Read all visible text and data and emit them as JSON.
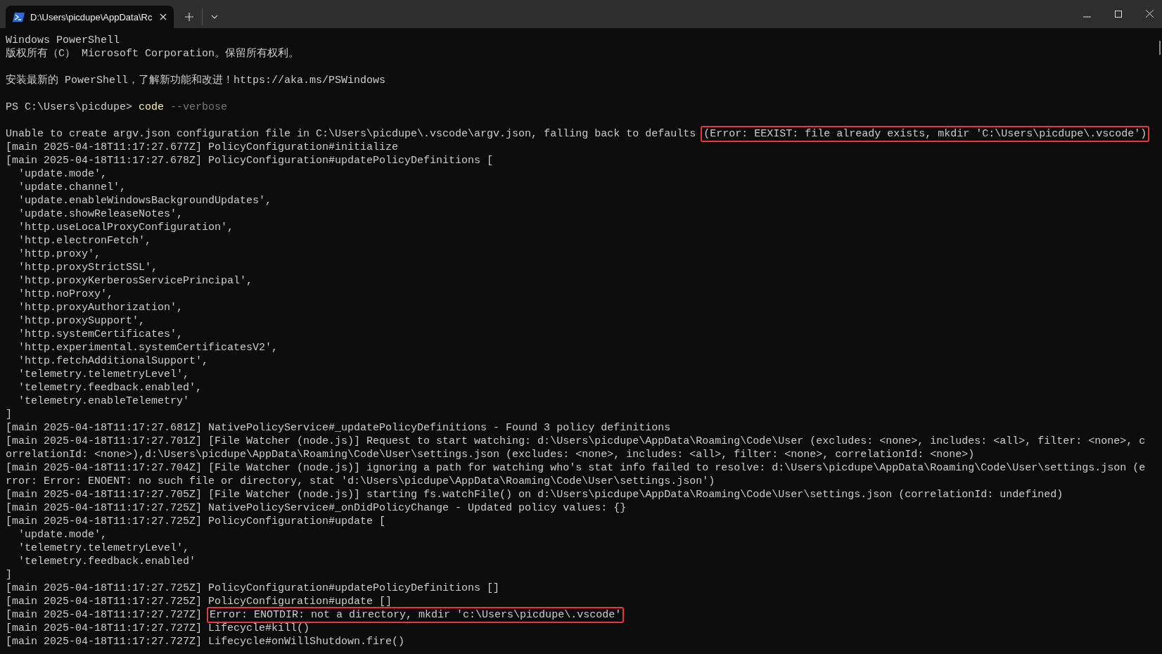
{
  "window": {
    "tab": {
      "title": "D:\\Users\\picdupe\\AppData\\Rc",
      "selected": true
    }
  },
  "terminal": {
    "lines": [
      {
        "kind": "text",
        "segments": [
          {
            "kind": "plain",
            "text": "Windows PowerShell"
          }
        ]
      },
      {
        "kind": "text",
        "segments": [
          {
            "kind": "plain",
            "text": "版权所有（C） Microsoft Corporation。保留所有权利。"
          }
        ]
      },
      {
        "kind": "blank"
      },
      {
        "kind": "text",
        "segments": [
          {
            "kind": "plain",
            "text": "安装最新的 PowerShell，了解新功能和改进！https://aka.ms/PSWindows"
          }
        ]
      },
      {
        "kind": "blank"
      },
      {
        "kind": "text",
        "segments": [
          {
            "kind": "prompt",
            "text": "PS C:\\Users\\picdupe> "
          },
          {
            "kind": "command",
            "text": "code"
          },
          {
            "kind": "parameter",
            "text": " --verbose"
          }
        ]
      },
      {
        "kind": "blank"
      },
      {
        "kind": "text",
        "segments": [
          {
            "kind": "plain",
            "text": "Unable to create argv.json configuration file in C:\\Users\\picdupe\\.vscode\\argv.json, falling back to defaults "
          },
          {
            "kind": "highlight",
            "text": "(Error: EEXIST: file already exists, mkdir 'C:\\Users\\picdupe\\.vscode')"
          }
        ]
      },
      {
        "kind": "text",
        "segments": [
          {
            "kind": "plain",
            "text": "[main 2025-04-18T11:17:27.677Z] PolicyConfiguration#initialize"
          }
        ]
      },
      {
        "kind": "text",
        "segments": [
          {
            "kind": "plain",
            "text": "[main 2025-04-18T11:17:27.678Z] PolicyConfiguration#updatePolicyDefinitions ["
          }
        ]
      },
      {
        "kind": "text",
        "segments": [
          {
            "kind": "plain",
            "text": "  'update.mode',"
          }
        ]
      },
      {
        "kind": "text",
        "segments": [
          {
            "kind": "plain",
            "text": "  'update.channel',"
          }
        ]
      },
      {
        "kind": "text",
        "segments": [
          {
            "kind": "plain",
            "text": "  'update.enableWindowsBackgroundUpdates',"
          }
        ]
      },
      {
        "kind": "text",
        "segments": [
          {
            "kind": "plain",
            "text": "  'update.showReleaseNotes',"
          }
        ]
      },
      {
        "kind": "text",
        "segments": [
          {
            "kind": "plain",
            "text": "  'http.useLocalProxyConfiguration',"
          }
        ]
      },
      {
        "kind": "text",
        "segments": [
          {
            "kind": "plain",
            "text": "  'http.electronFetch',"
          }
        ]
      },
      {
        "kind": "text",
        "segments": [
          {
            "kind": "plain",
            "text": "  'http.proxy',"
          }
        ]
      },
      {
        "kind": "text",
        "segments": [
          {
            "kind": "plain",
            "text": "  'http.proxyStrictSSL',"
          }
        ]
      },
      {
        "kind": "text",
        "segments": [
          {
            "kind": "plain",
            "text": "  'http.proxyKerberosServicePrincipal',"
          }
        ]
      },
      {
        "kind": "text",
        "segments": [
          {
            "kind": "plain",
            "text": "  'http.noProxy',"
          }
        ]
      },
      {
        "kind": "text",
        "segments": [
          {
            "kind": "plain",
            "text": "  'http.proxyAuthorization',"
          }
        ]
      },
      {
        "kind": "text",
        "segments": [
          {
            "kind": "plain",
            "text": "  'http.proxySupport',"
          }
        ]
      },
      {
        "kind": "text",
        "segments": [
          {
            "kind": "plain",
            "text": "  'http.systemCertificates',"
          }
        ]
      },
      {
        "kind": "text",
        "segments": [
          {
            "kind": "plain",
            "text": "  'http.experimental.systemCertificatesV2',"
          }
        ]
      },
      {
        "kind": "text",
        "segments": [
          {
            "kind": "plain",
            "text": "  'http.fetchAdditionalSupport',"
          }
        ]
      },
      {
        "kind": "text",
        "segments": [
          {
            "kind": "plain",
            "text": "  'telemetry.telemetryLevel',"
          }
        ]
      },
      {
        "kind": "text",
        "segments": [
          {
            "kind": "plain",
            "text": "  'telemetry.feedback.enabled',"
          }
        ]
      },
      {
        "kind": "text",
        "segments": [
          {
            "kind": "plain",
            "text": "  'telemetry.enableTelemetry'"
          }
        ]
      },
      {
        "kind": "text",
        "segments": [
          {
            "kind": "plain",
            "text": "]"
          }
        ]
      },
      {
        "kind": "text",
        "segments": [
          {
            "kind": "plain",
            "text": "[main 2025-04-18T11:17:27.681Z] NativePolicyService#_updatePolicyDefinitions - Found 3 policy definitions"
          }
        ]
      },
      {
        "kind": "text",
        "segments": [
          {
            "kind": "plain",
            "text": "[main 2025-04-18T11:17:27.701Z] [File Watcher (node.js)] Request to start watching: d:\\Users\\picdupe\\AppData\\Roaming\\Code\\User (excludes: <none>, includes: <all>, filter: <none>, c"
          }
        ]
      },
      {
        "kind": "text",
        "segments": [
          {
            "kind": "plain",
            "text": "orrelationId: <none>),d:\\Users\\picdupe\\AppData\\Roaming\\Code\\User\\settings.json (excludes: <none>, includes: <all>, filter: <none>, correlationId: <none>)"
          }
        ]
      },
      {
        "kind": "text",
        "segments": [
          {
            "kind": "plain",
            "text": "[main 2025-04-18T11:17:27.704Z] [File Watcher (node.js)] ignoring a path for watching who's stat info failed to resolve: d:\\Users\\picdupe\\AppData\\Roaming\\Code\\User\\settings.json (e"
          }
        ]
      },
      {
        "kind": "text",
        "segments": [
          {
            "kind": "plain",
            "text": "rror: Error: ENOENT: no such file or directory, stat 'd:\\Users\\picdupe\\AppData\\Roaming\\Code\\User\\settings.json')"
          }
        ]
      },
      {
        "kind": "text",
        "segments": [
          {
            "kind": "plain",
            "text": "[main 2025-04-18T11:17:27.705Z] [File Watcher (node.js)] starting fs.watchFile() on d:\\Users\\picdupe\\AppData\\Roaming\\Code\\User\\settings.json (correlationId: undefined)"
          }
        ]
      },
      {
        "kind": "text",
        "segments": [
          {
            "kind": "plain",
            "text": "[main 2025-04-18T11:17:27.725Z] NativePolicyService#_onDidPolicyChange - Updated policy values: {}"
          }
        ]
      },
      {
        "kind": "text",
        "segments": [
          {
            "kind": "plain",
            "text": "[main 2025-04-18T11:17:27.725Z] PolicyConfiguration#update ["
          }
        ]
      },
      {
        "kind": "text",
        "segments": [
          {
            "kind": "plain",
            "text": "  'update.mode',"
          }
        ]
      },
      {
        "kind": "text",
        "segments": [
          {
            "kind": "plain",
            "text": "  'telemetry.telemetryLevel',"
          }
        ]
      },
      {
        "kind": "text",
        "segments": [
          {
            "kind": "plain",
            "text": "  'telemetry.feedback.enabled'"
          }
        ]
      },
      {
        "kind": "text",
        "segments": [
          {
            "kind": "plain",
            "text": "]"
          }
        ]
      },
      {
        "kind": "text",
        "segments": [
          {
            "kind": "plain",
            "text": "[main 2025-04-18T11:17:27.725Z] PolicyConfiguration#updatePolicyDefinitions []"
          }
        ]
      },
      {
        "kind": "text",
        "segments": [
          {
            "kind": "plain",
            "text": "[main 2025-04-18T11:17:27.725Z] PolicyConfiguration#update []"
          }
        ]
      },
      {
        "kind": "text",
        "segments": [
          {
            "kind": "plain",
            "text": "[main 2025-04-18T11:17:27.727Z] "
          },
          {
            "kind": "highlight",
            "text": "Error: ENOTDIR: not a directory, mkdir 'c:\\Users\\picdupe\\.vscode'"
          }
        ]
      },
      {
        "kind": "text",
        "segments": [
          {
            "kind": "plain",
            "text": "[main 2025-04-18T11:17:27.727Z] Lifecycle#kill()"
          }
        ]
      },
      {
        "kind": "text",
        "segments": [
          {
            "kind": "plain",
            "text": "[main 2025-04-18T11:17:27.727Z] Lifecycle#onWillShutdown.fire()"
          }
        ]
      }
    ]
  }
}
